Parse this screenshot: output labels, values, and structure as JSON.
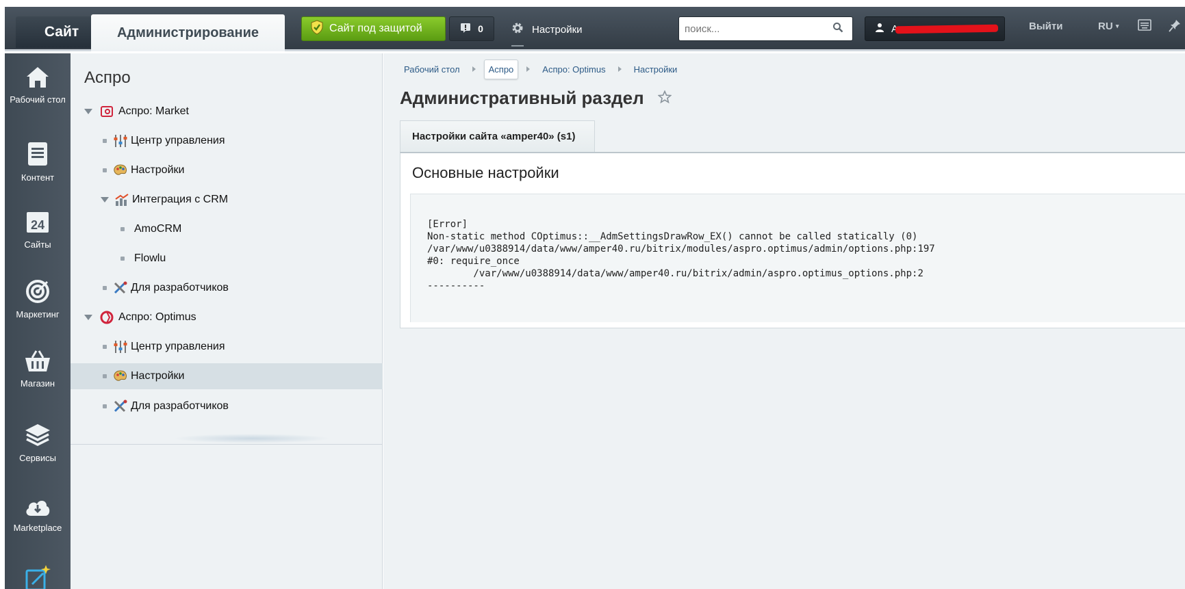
{
  "header": {
    "site_button": "Сайт",
    "admin_tab": "Администрирование",
    "protect_label": "Сайт под защитой",
    "notifications_count": "0",
    "settings_label": "Настройки",
    "search_placeholder": "поиск...",
    "user_initial": "А",
    "logout_label": "Выйти",
    "lang_label": "RU",
    "protect_color": "#6db31d"
  },
  "leftnav": {
    "items": [
      {
        "label": "Рабочий стол",
        "icon": "home-icon"
      },
      {
        "label": "Контент",
        "icon": "document-icon"
      },
      {
        "label": "Сайты",
        "icon": "calendar-24-icon",
        "badge": "24"
      },
      {
        "label": "Маркетинг",
        "icon": "target-icon"
      },
      {
        "label": "Магазин",
        "icon": "basket-icon"
      },
      {
        "label": "Сервисы",
        "icon": "layers-icon"
      },
      {
        "label": "Marketplace",
        "icon": "cloud-download-icon"
      }
    ]
  },
  "submenu": {
    "title": "Аспро",
    "items": [
      {
        "label": "Аспро: Market",
        "icon": "aspro-market-icon",
        "level": 0
      },
      {
        "label": "Центр управления",
        "icon": "sliders-icon",
        "level": 1
      },
      {
        "label": "Настройки",
        "icon": "palette-icon",
        "level": 1
      },
      {
        "label": "Интеграция с CRM",
        "icon": "chart-icon",
        "level": 1
      },
      {
        "label": "AmoCRM",
        "level": 2
      },
      {
        "label": "Flowlu",
        "level": 2
      },
      {
        "label": "Для разработчиков",
        "icon": "tools-icon",
        "level": 1
      },
      {
        "label": "Аспро: Optimus",
        "icon": "aspro-optimus-icon",
        "level": 0
      },
      {
        "label": "Центр управления",
        "icon": "sliders-icon",
        "level": 1
      },
      {
        "label": "Настройки",
        "icon": "palette-icon",
        "level": 1,
        "active": true
      },
      {
        "label": "Для разработчиков",
        "icon": "tools-icon",
        "level": 1
      }
    ]
  },
  "breadcrumbs": [
    "Рабочий стол",
    "Аспро",
    "Аспро: Optimus",
    "Настройки"
  ],
  "page_title": "Административный раздел",
  "tab_label": "Настройки сайта «amper40» (s1)",
  "section_heading": "Основные настройки",
  "error_text": "[Error]\nNon-static method COptimus::__AdmSettingsDrawRow_EX() cannot be called statically (0)\n/var/www/u0388914/data/www/amper40.ru/bitrix/modules/aspro.optimus/admin/options.php:197\n#0: require_once\n        /var/www/u0388914/data/www/amper40.ru/bitrix/admin/aspro.optimus_options.php:2\n----------"
}
